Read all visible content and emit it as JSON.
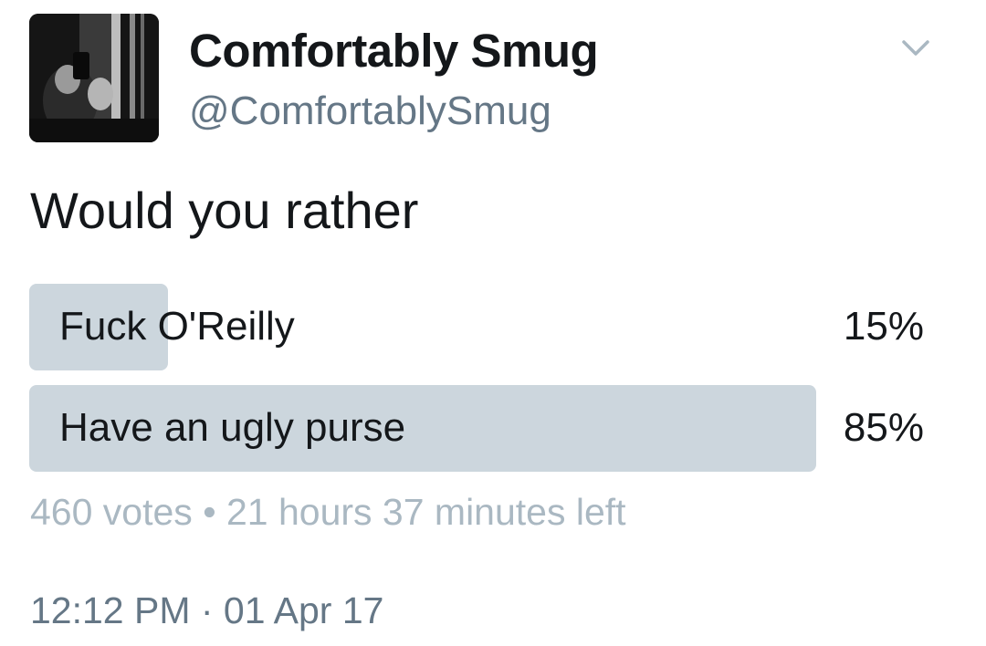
{
  "user": {
    "display_name": "Comfortably Smug",
    "handle": "@ComfortablySmug",
    "avatar_icon": "profile-photo"
  },
  "menu": {
    "icon": "chevron-down-icon"
  },
  "tweet": {
    "text": "Would you rather"
  },
  "poll": {
    "options": [
      {
        "label": "Fuck O'Reilly",
        "percent_label": "15%",
        "fraction": 0.15
      },
      {
        "label": "Have an ugly purse",
        "percent_label": "85%",
        "fraction": 0.85
      }
    ],
    "votes": "460 votes",
    "separator": "•",
    "time_left": "21 hours 37 minutes left"
  },
  "timestamp": "12:12 PM · 01 Apr 17",
  "colors": {
    "bar": "#ccd6dd",
    "text": "#14171a",
    "secondary": "#657786",
    "meta": "#aab8c2"
  }
}
